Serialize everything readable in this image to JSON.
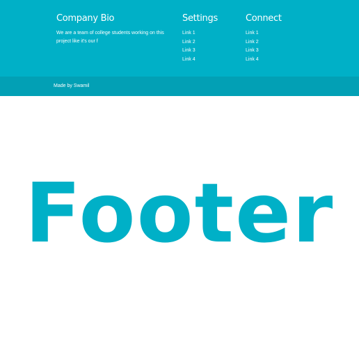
{
  "footer": {
    "bio": {
      "heading": "Company Bio",
      "text": "We are a team of college students working on this project like it's our f"
    },
    "settings": {
      "heading": "Settings",
      "links": [
        "Link 1",
        "Link 2",
        "Link 3",
        "Link 4"
      ]
    },
    "connect": {
      "heading": "Connect",
      "links": [
        "Link 1",
        "Link 2",
        "Link 3",
        "Link 4"
      ]
    },
    "credit": "Made by Swamil"
  },
  "page": {
    "title": "Footer"
  },
  "colors": {
    "accent": "#00b0c7",
    "accent_dark": "#02a0b5",
    "text_on_accent": "#ffffff"
  }
}
